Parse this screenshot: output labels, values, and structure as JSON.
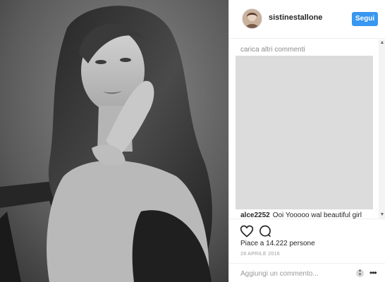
{
  "post": {
    "photo_description_icon": "portrait-photo",
    "username": "sistinestallone",
    "follow_label": "Segui"
  },
  "comments": {
    "load_more": "carica altri commenti",
    "partial_comment_user": "alce2252",
    "partial_comment_text": "Ooi Yooooo wal beautiful girl"
  },
  "engagement": {
    "likes": "Piace a 14.222 persone",
    "date": "28 APRILE 2016"
  },
  "composer": {
    "placeholder": "Aggiungi un commento...",
    "more_label": "•••"
  },
  "colors": {
    "accent": "#3897f0",
    "text": "#262626",
    "muted": "#999999"
  },
  "icons": [
    "heart-icon",
    "comment-icon",
    "scroll-up-icon",
    "scroll-down-icon",
    "more-options-icon"
  ]
}
